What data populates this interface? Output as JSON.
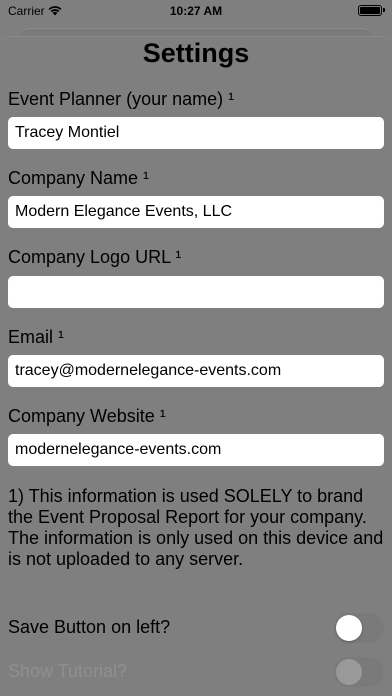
{
  "status_bar": {
    "carrier": "Carrier",
    "time": "10:27 AM"
  },
  "title": "Settings",
  "fields": [
    {
      "label": "Event Planner (your name) ¹",
      "value": "Tracey Montiel",
      "placeholder": ""
    },
    {
      "label": "Company Name ¹",
      "value": "Modern Elegance Events, LLC",
      "placeholder": ""
    },
    {
      "label": "Company Logo URL ¹",
      "value": "",
      "placeholder": ""
    },
    {
      "label": "Email ¹",
      "value": "tracey@modernelegance-events.com",
      "placeholder": ""
    },
    {
      "label": "Company Website ¹",
      "value": "modernelegance-events.com",
      "placeholder": ""
    }
  ],
  "note": "1) This information is used SOLELY to brand the Event Proposal Report for your company. The information is only used on this device and is not uploaded to any server.",
  "toggles": [
    {
      "label": "Save Button on left?",
      "on": false
    },
    {
      "label": "Show Tutorial?",
      "on": false
    }
  ],
  "colors": {
    "overlay_background": "#7f7f7f",
    "input_background": "#ffffff"
  }
}
